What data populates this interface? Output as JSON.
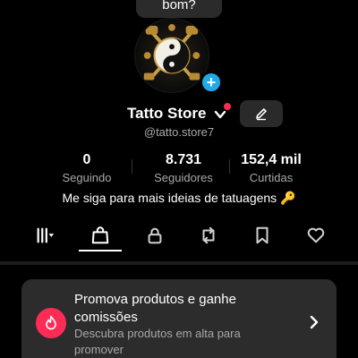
{
  "bubble": {
    "text": "bom?"
  },
  "profile": {
    "name": "Tatto Store",
    "handle": "@tatto.store7",
    "bio": "Me siga para mais ideias de tatuagens 🔑"
  },
  "stats": [
    {
      "value": "0",
      "label": "Seguindo"
    },
    {
      "value": "8.731",
      "label": "Seguidores"
    },
    {
      "value": "152,4 mil",
      "label": "Curtidas"
    }
  ],
  "tabs": [
    {
      "icon": "grid-icon",
      "active": false
    },
    {
      "icon": "shopping-bag-icon",
      "active": true
    },
    {
      "icon": "lock-icon",
      "active": false
    },
    {
      "icon": "repost-icon",
      "active": false
    },
    {
      "icon": "bookmark-icon",
      "active": false
    },
    {
      "icon": "heart-icon",
      "active": false
    }
  ],
  "promo": {
    "title": "Promova produtos e ganhe comissões",
    "subtitle": "Descubra produtos em alta para promover"
  },
  "colors": {
    "accent_red": "#fe2c55",
    "badge_blue": "#20a9e8",
    "muted_text": "#a8a8a8"
  }
}
